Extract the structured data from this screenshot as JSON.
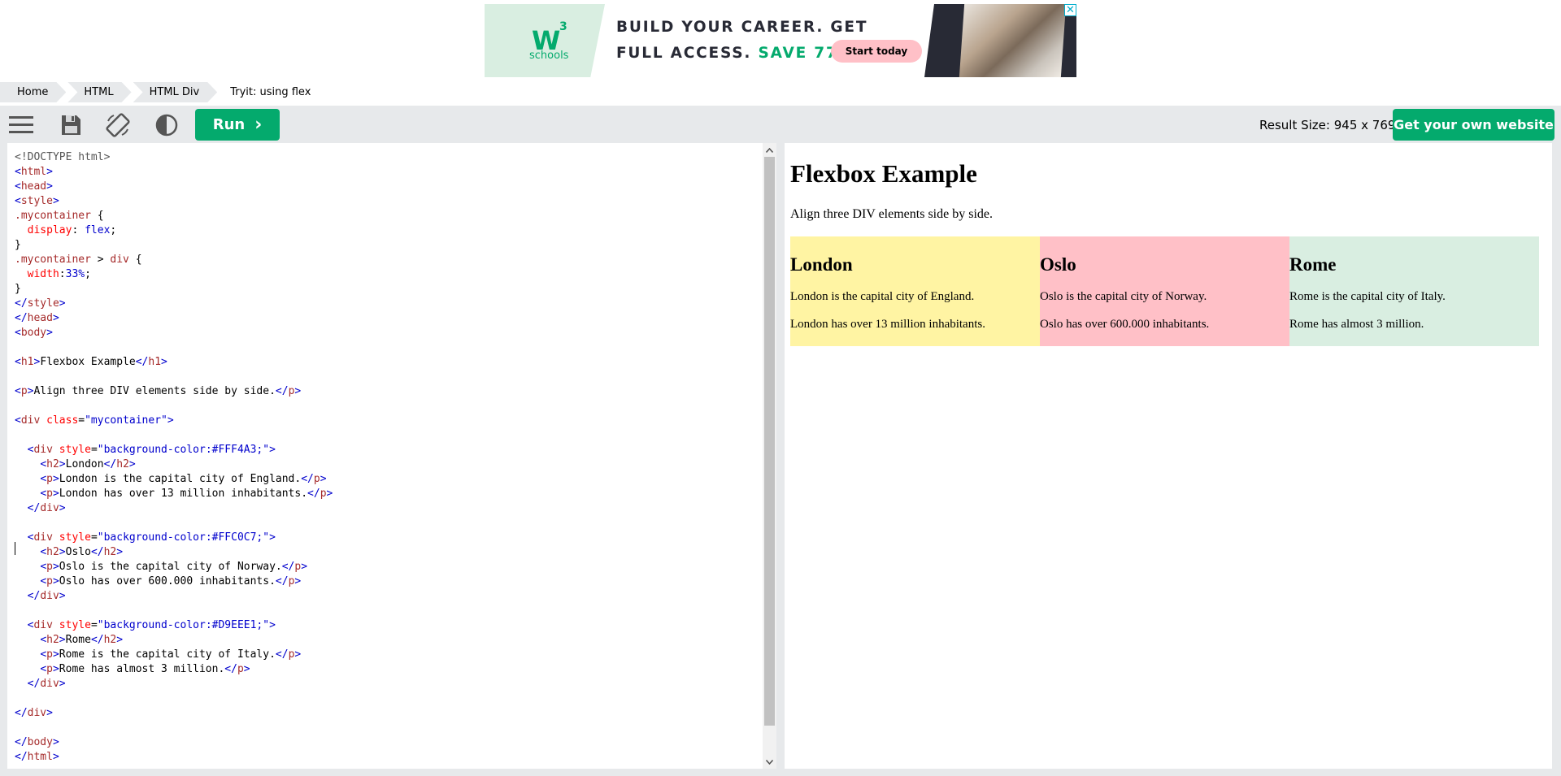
{
  "ad": {
    "logo_mark": "W",
    "logo_sup": "3",
    "logo_text": "schools",
    "line1": "BUILD YOUR CAREER. GET",
    "line2_prefix": "FULL ACCESS. ",
    "line2_highlight": "SAVE 770$",
    "button_label": "Start today",
    "close_label": "✕",
    "brand_color": "#04aa6d",
    "button_color": "#ffc0c7"
  },
  "breadcrumb": [
    {
      "label": "Home"
    },
    {
      "label": "HTML"
    },
    {
      "label": "HTML Div"
    },
    {
      "label": "Tryit: using flex"
    }
  ],
  "toolbar": {
    "icons": [
      "menu-icon",
      "save-icon",
      "rotate-icon",
      "contrast-icon"
    ],
    "run_label": "Run",
    "run_arrow": "›",
    "result_size": "Result Size: 945 x 769",
    "own_website_label": "Get your own website",
    "accent": "#04aa6d"
  },
  "editor": {
    "lines": [
      "<!DOCTYPE html>",
      "<html>",
      "<head>",
      "<style>",
      ".mycontainer {",
      "  display: flex;",
      "}",
      ".mycontainer > div {",
      "  width:33%;",
      "}",
      "</style>",
      "</head>",
      "<body>",
      "",
      "<h1>Flexbox Example</h1>",
      "",
      "<p>Align three DIV elements side by side.</p>",
      "",
      "<div class=\"mycontainer\">",
      "",
      "  <div style=\"background-color:#FFF4A3;\">",
      "    <h2>London</h2>",
      "    <p>London is the capital city of England.</p>",
      "    <p>London has over 13 million inhabitants.</p>",
      "  </div>",
      "",
      "  <div style=\"background-color:#FFC0C7;\">",
      "    <h2>Oslo</h2>",
      "    <p>Oslo is the capital city of Norway.</p>",
      "    <p>Oslo has over 600.000 inhabitants.</p>",
      "  </div>",
      "",
      "  <div style=\"background-color:#D9EEE1;\">",
      "    <h2>Rome</h2>",
      "    <p>Rome is the capital city of Italy.</p>",
      "    <p>Rome has almost 3 million.</p>",
      "  </div>",
      "",
      "</div>",
      "",
      "</body>",
      "</html>"
    ]
  },
  "result": {
    "heading": "Flexbox Example",
    "paragraph": "Align three DIV elements side by side.",
    "cities": [
      {
        "name": "London",
        "line1": "London is the capital city of England.",
        "line2": "London has over 13 million inhabitants.",
        "color": "#FFF4A3"
      },
      {
        "name": "Oslo",
        "line1": "Oslo is the capital city of Norway.",
        "line2": "Oslo has over 600.000 inhabitants.",
        "color": "#FFC0C7"
      },
      {
        "name": "Rome",
        "line1": "Rome is the capital city of Italy.",
        "line2": "Rome has almost 3 million.",
        "color": "#D9EEE1"
      }
    ]
  }
}
